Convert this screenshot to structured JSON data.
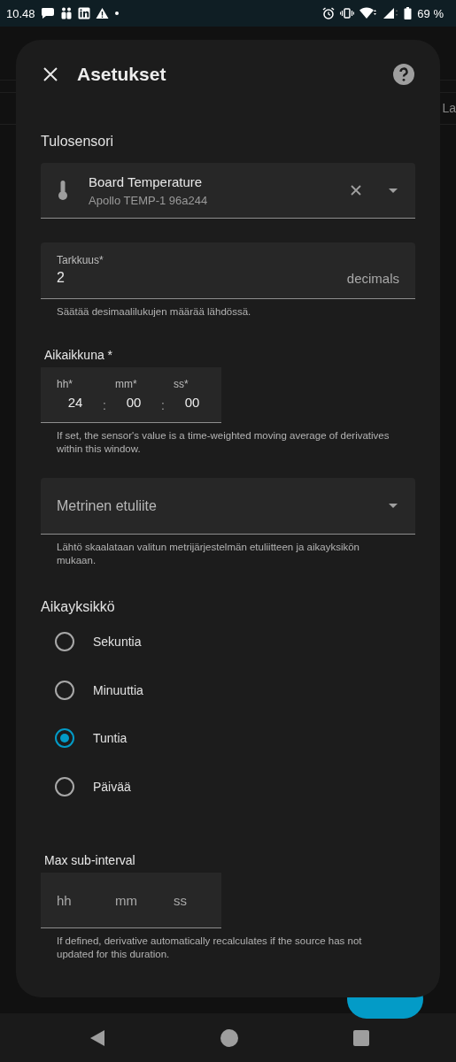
{
  "status_bar": {
    "time": "10.48",
    "battery": "69 %"
  },
  "background": {
    "text": "La"
  },
  "dialog": {
    "title": "Asetukset",
    "input_sensor": {
      "label": "Tulosensori",
      "name": "Board Temperature",
      "device": "Apollo TEMP-1 96a244"
    },
    "precision": {
      "label": "Tarkkuus*",
      "value": "2",
      "suffix": "decimals",
      "helper": "Säätää desimaalilukujen määrää lähdössä."
    },
    "time_window": {
      "label": "Aikaikkuna *",
      "fields": [
        {
          "label": "hh*",
          "value": "24"
        },
        {
          "label": "mm*",
          "value": "00"
        },
        {
          "label": "ss*",
          "value": "00"
        }
      ],
      "separators": [
        ":",
        ":"
      ],
      "helper": "If set, the sensor's value is a time-weighted moving average of derivatives within this window."
    },
    "metric_prefix": {
      "placeholder": "Metrinen etuliite",
      "helper": "Lähtö skaalataan valitun metrijärjestelmän etuliitteen ja aikayksikön mukaan."
    },
    "time_unit": {
      "label": "Aikayksikkö",
      "options": [
        {
          "label": "Sekuntia",
          "selected": false
        },
        {
          "label": "Minuuttia",
          "selected": false
        },
        {
          "label": "Tuntia",
          "selected": true
        },
        {
          "label": "Päivää",
          "selected": false
        }
      ]
    },
    "max_sub_interval": {
      "label": "Max sub-interval",
      "fields": [
        {
          "placeholder": "hh"
        },
        {
          "placeholder": "mm"
        },
        {
          "placeholder": "ss"
        }
      ],
      "helper": "If defined, derivative automatically recalculates if the source has not updated for this duration."
    }
  }
}
